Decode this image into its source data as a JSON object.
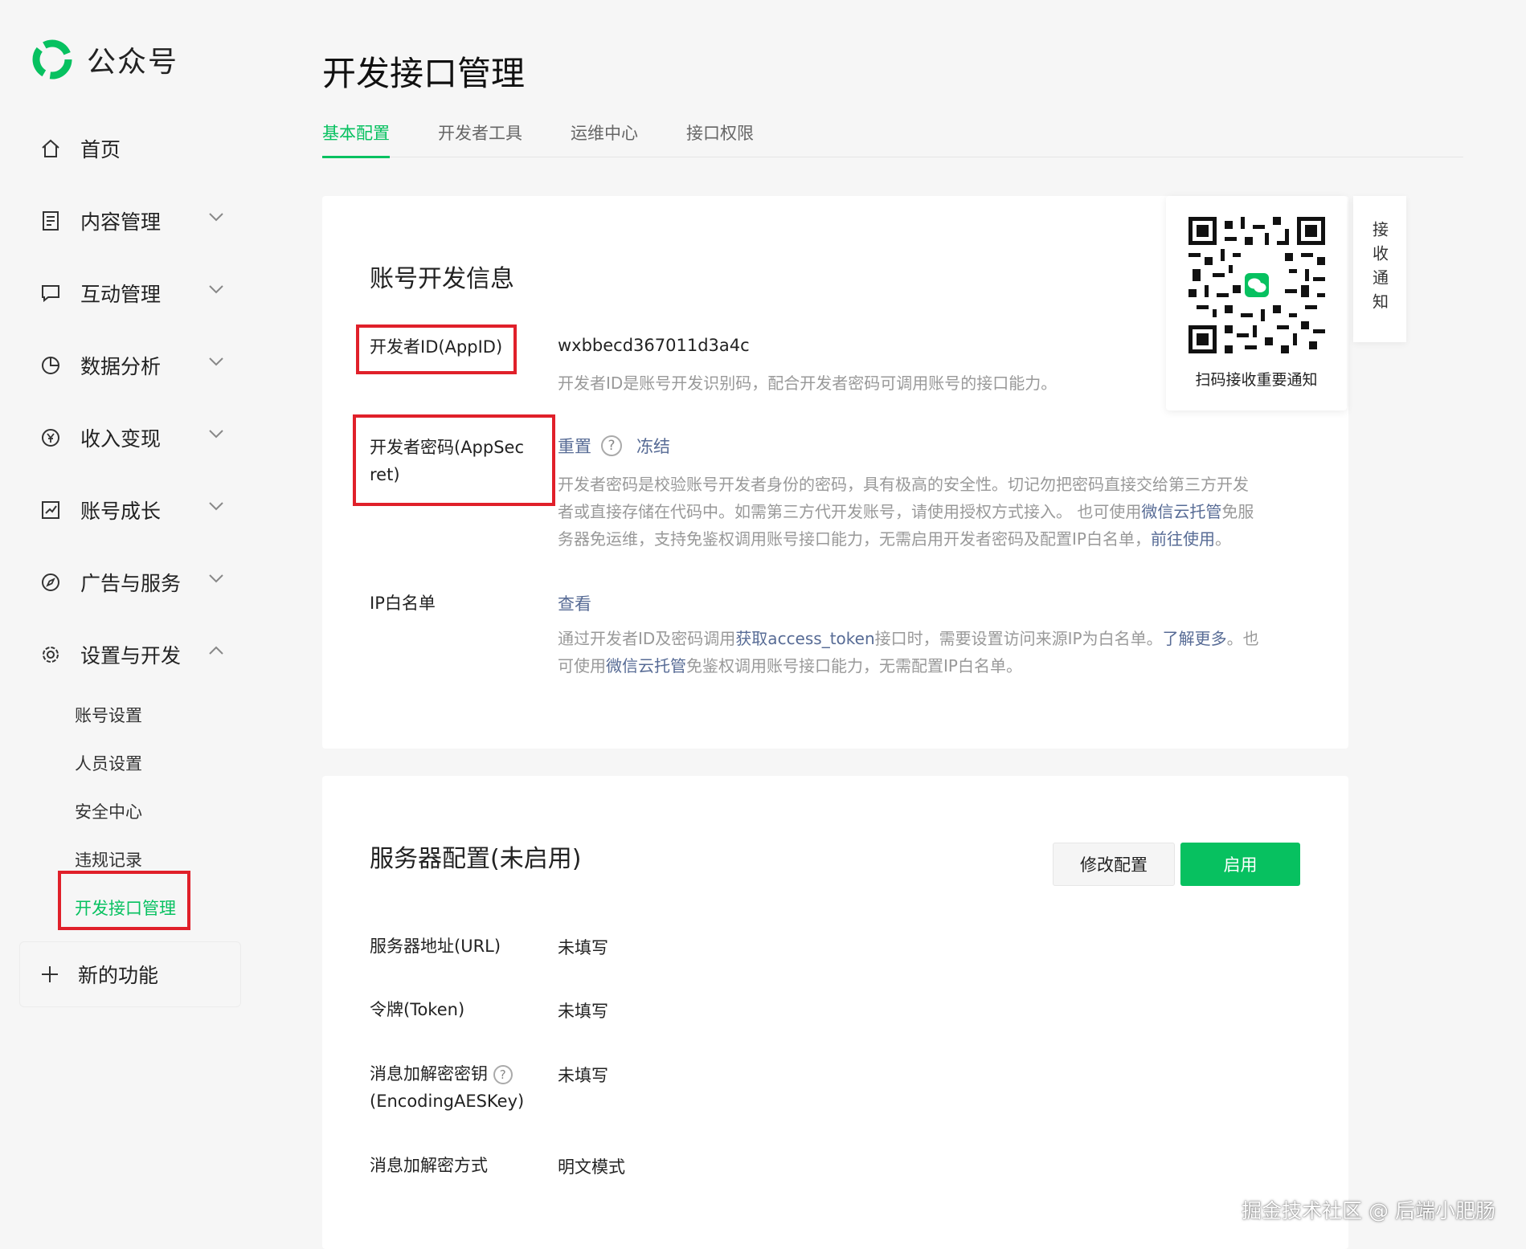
{
  "app": {
    "name": "公众号"
  },
  "colors": {
    "brand": "#07c160",
    "link": "#576b95",
    "highlight": "#e0202a"
  },
  "sidebar": {
    "items": [
      {
        "label": "首页",
        "icon": "home-icon"
      },
      {
        "label": "内容管理",
        "icon": "document-icon"
      },
      {
        "label": "互动管理",
        "icon": "chat-icon"
      },
      {
        "label": "数据分析",
        "icon": "pie-chart-icon"
      },
      {
        "label": "收入变现",
        "icon": "yen-icon"
      },
      {
        "label": "账号成长",
        "icon": "growth-chart-icon"
      },
      {
        "label": "广告与服务",
        "icon": "compass-icon"
      },
      {
        "label": "设置与开发",
        "icon": "gear-icon"
      }
    ],
    "subitems": [
      "账号设置",
      "人员设置",
      "安全中心",
      "违规记录",
      "开发接口管理"
    ],
    "new_feature": "新的功能"
  },
  "page": {
    "title": "开发接口管理",
    "tabs": [
      "基本配置",
      "开发者工具",
      "运维中心",
      "接口权限"
    ]
  },
  "dev_info": {
    "title": "账号开发信息",
    "appid_label": "开发者ID(AppID)",
    "appid_value": "wxbbecd367011d3a4c",
    "appid_desc": "开发者ID是账号开发识别码，配合开发者密码可调用账号的接口能力。",
    "secret_label_1": "开发者密码(AppSec",
    "secret_label_2": "ret)",
    "reset": "重置",
    "freeze": "冻结",
    "secret_desc_1": "开发者密码是校验账号开发者身份的密码，具有极高的安全性。切记勿把密码直接交给第三方开发",
    "secret_desc_2a": "者或直接存储在代码中。如需第三方代开发账号，请使用授权方式接入。 也可使用",
    "secret_desc_2_link": "微信云托管",
    "secret_desc_2b": "免服",
    "secret_desc_3a": "务器免运维，支持免鉴权调用账号接口能力，无需启用开发者密码及配置IP白名单，",
    "secret_desc_3_link": "前往使用",
    "secret_desc_3b": "。",
    "ip_label": "IP白名单",
    "ip_view": "查看",
    "ip_desc_1a": "通过开发者ID及密码调用",
    "ip_desc_1_link1": "获取access_token",
    "ip_desc_1b": "接口时，需要设置访问来源IP为白名单。",
    "ip_desc_1_link2": "了解更多",
    "ip_desc_1c": "。也",
    "ip_desc_2a": "可使用",
    "ip_desc_2_link": "微信云托管",
    "ip_desc_2b": "免鉴权调用账号接口能力，无需配置IP白名单。"
  },
  "qr": {
    "caption": "扫码接收重要通知",
    "side": "接收通知"
  },
  "server": {
    "title": "服务器配置(未启用)",
    "modify": "修改配置",
    "enable": "启用",
    "url_label": "服务器地址(URL)",
    "url_value": "未填写",
    "token_label": "令牌(Token)",
    "token_value": "未填写",
    "aes_label_1": "消息加解密密钥",
    "aes_label_2": "(EncodingAESKey)",
    "aes_value": "未填写",
    "mode_label": "消息加解密方式",
    "mode_value": "明文模式"
  },
  "watermark": "掘金技术社区 @ 后端小肥肠",
  "icon_glyphs": {
    "help": "?"
  }
}
